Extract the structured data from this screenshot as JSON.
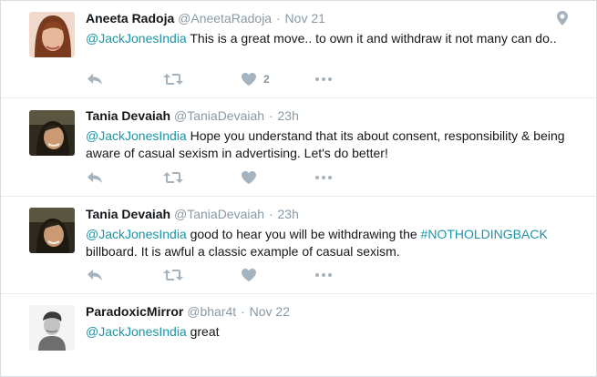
{
  "tweets": [
    {
      "name": "Aneeta Radoja",
      "handle": "@AneetaRadoja",
      "separator": "·",
      "time": "Nov 21",
      "mention": "@JackJonesIndia",
      "text_before_hashtag": " This is a great move.. to own it and withdraw it not many can do..",
      "hashtag": "",
      "text_after_hashtag": "",
      "like_count": "2",
      "show_location_icon": true
    },
    {
      "name": "Tania Devaiah",
      "handle": "@TaniaDevaiah",
      "separator": "·",
      "time": "23h",
      "mention": "@JackJonesIndia",
      "text_before_hashtag": " Hope you understand that its about consent, responsibility & being aware of casual sexism in advertising. Let's do better!",
      "hashtag": "",
      "text_after_hashtag": "",
      "like_count": "",
      "show_location_icon": false
    },
    {
      "name": "Tania Devaiah",
      "handle": "@TaniaDevaiah",
      "separator": "·",
      "time": "23h",
      "mention": "@JackJonesIndia",
      "text_before_hashtag": " good to hear you will be withdrawing the ",
      "hashtag": "#NOTHOLDINGBACK",
      "text_after_hashtag": " billboard. It is awful a classic example of casual sexism.",
      "like_count": "",
      "show_location_icon": false
    },
    {
      "name": "ParadoxicMirror",
      "handle": "@bhar4t",
      "separator": "·",
      "time": "Nov 22",
      "mention": "@JackJonesIndia",
      "text_before_hashtag": " great",
      "hashtag": "",
      "text_after_hashtag": "",
      "like_count": "",
      "show_location_icon": false
    }
  ],
  "icons": {
    "reply": "reply-icon",
    "retweet": "retweet-icon",
    "like": "heart-icon",
    "more": "more-icon",
    "location": "location-pin-icon"
  },
  "colors": {
    "link": "#1b95a8",
    "muted": "#8899a6",
    "icon": "#a5b3bf",
    "divider": "#e6ecf0"
  }
}
